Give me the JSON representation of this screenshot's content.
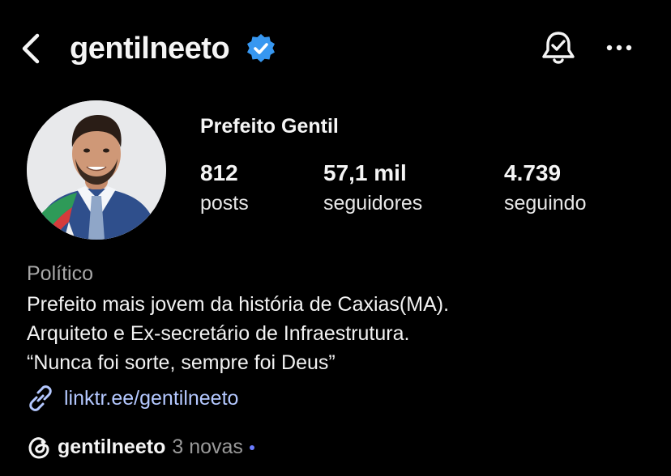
{
  "header": {
    "username": "gentilneeto",
    "icons": {
      "back": "back-chevron-icon",
      "verified": "verified-badge-icon",
      "notifications": "bell-check-icon",
      "more": "more-options-icon"
    },
    "verified_color": "#3797f0"
  },
  "profile": {
    "full_name": "Prefeito Gentil",
    "stats": [
      {
        "value": "812",
        "label": "posts"
      },
      {
        "value": "57,1 mil",
        "label": "seguidores"
      },
      {
        "value": "4.739",
        "label": "seguindo"
      }
    ],
    "category": "Político",
    "bio": [
      "Prefeito mais jovem da história de Caxias(MA).",
      "Arquiteto e Ex-secretário de Infraestrutura.",
      "“Nunca foi sorte, sempre foi Deus”"
    ],
    "link": "linktr.ee/gentilneeto",
    "link_color": "#b4c8ff"
  },
  "threads": {
    "username": "gentilneeto",
    "new_label": "3 novas",
    "dot_color": "#6b7cff"
  }
}
